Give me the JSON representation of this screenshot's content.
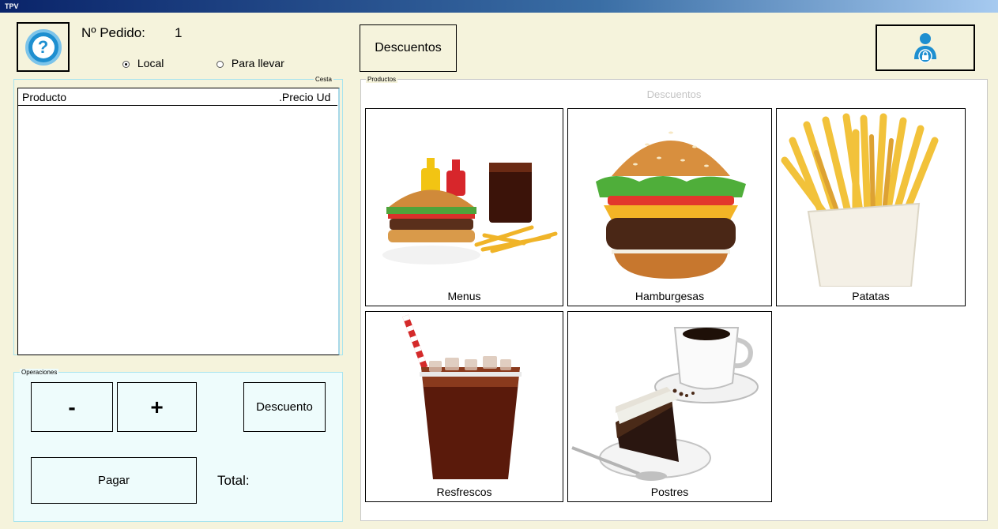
{
  "window": {
    "title": "TPV"
  },
  "header": {
    "help_icon": "question-icon",
    "order_label": "Nº Pedido:",
    "order_number": "1",
    "options": [
      {
        "label": "Local",
        "selected": true
      },
      {
        "label": "Para llevar",
        "selected": false
      }
    ],
    "discount_button": "Descuentos",
    "user_icon": "user-lock-icon"
  },
  "basket": {
    "group_label": "Cesta",
    "columns": [
      "Producto",
      "Precio Ud"
    ],
    "rows": []
  },
  "operations": {
    "group_label": "Operaciones",
    "minus": "-",
    "plus": "+",
    "discount": "Descuento",
    "pay": "Pagar",
    "total_label": "Total:"
  },
  "products": {
    "group_label": "Productos",
    "section_title": "Descuentos",
    "items": [
      {
        "label": "Menus",
        "icon": "menu-combo-icon"
      },
      {
        "label": "Hamburgesas",
        "icon": "burger-icon"
      },
      {
        "label": "Patatas",
        "icon": "fries-icon"
      },
      {
        "label": "Resfrescos",
        "icon": "soda-icon"
      },
      {
        "label": "Postres",
        "icon": "dessert-icon"
      }
    ]
  },
  "colors": {
    "accent": "#1e8fd0",
    "panel": "#eefcfc",
    "background": "#f5f3dc",
    "group_border": "#a8e4ee"
  }
}
